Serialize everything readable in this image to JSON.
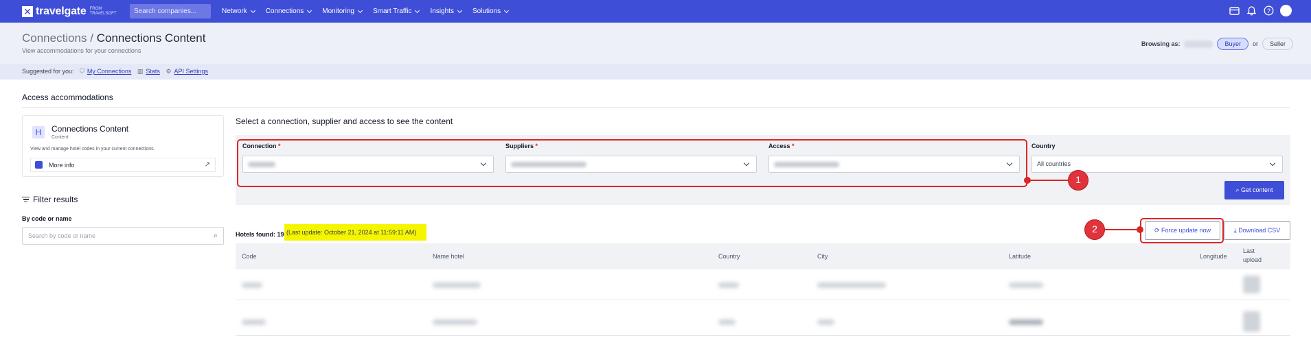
{
  "topbar": {
    "brand": "travelgate",
    "brand_sub_1": "FROM",
    "brand_sub_2": "TRAVELSOFT",
    "search_placeholder": "Search companies...",
    "nav": [
      "Network",
      "Connections",
      "Monitoring",
      "Smart Traffic",
      "Insights",
      "Solutions"
    ]
  },
  "header": {
    "crumb_parent": "Connections",
    "crumb_sep": "/",
    "crumb_current": "Connections Content",
    "subtitle": "View accommodations for your connections",
    "browsing_label": "Browsing as:",
    "buyer": "Buyer",
    "or": "or",
    "seller": "Seller"
  },
  "suggest": {
    "label": "Suggested for you:",
    "links": [
      "My Connections",
      "Stats",
      "API Settings"
    ]
  },
  "section_title": "Access accommodations",
  "card": {
    "icon_letter": "H",
    "title": "Connections Content",
    "sub": "Content",
    "desc": "View and manage hotel codes in your current connections.",
    "more_info": "More info"
  },
  "filter": {
    "title": "Filter results",
    "by_code": "By code or name",
    "search_placeholder": "Search by code or name"
  },
  "main": {
    "title": "Select a connection, supplier and access to see the content",
    "connection_label": "Connection",
    "suppliers_label": "Suppliers",
    "access_label": "Access",
    "required_mark": "*",
    "country_label": "Country",
    "country_value": "All countries",
    "get_content": "Get content"
  },
  "annotations": [
    "1",
    "2"
  ],
  "results": {
    "hotels_found": "Hotels found: 19.",
    "last_update": "(Last update: October 21, 2024 at 11:59:11 AM)",
    "force_update": "Force update now",
    "download_csv": "Download CSV"
  },
  "table": {
    "headers": [
      "Code",
      "Name hotel",
      "Country",
      "City",
      "Latitude",
      "Longitude",
      "Last upload"
    ]
  },
  "colors": {
    "primary": "#3f4ed7",
    "annotation": "#dc2626",
    "highlight": "#f5f500"
  }
}
